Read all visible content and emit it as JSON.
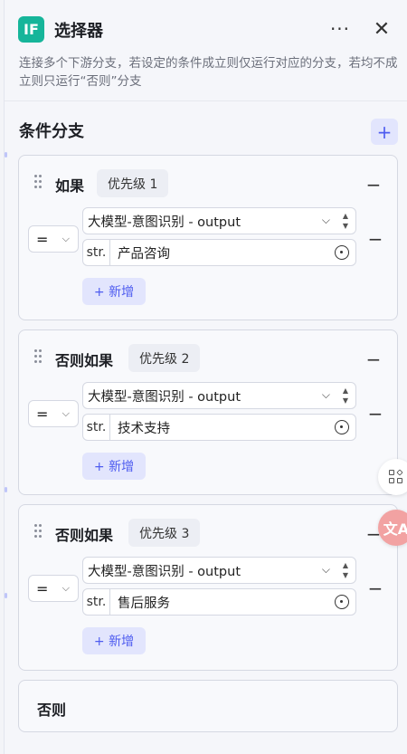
{
  "header": {
    "icon_text": "IF",
    "title": "选择器",
    "more_label": "···",
    "close_label": "✕",
    "description": "连接多个下游分支，若设定的条件成立则仅运行对应的分支，若均不成立则只运行“否则”分支"
  },
  "section": {
    "title": "条件分支",
    "add_label": "+"
  },
  "branches": [
    {
      "label": "如果",
      "priority": "优先级 1",
      "operator": "=",
      "variable": "大模型-意图识别 - output",
      "type_tag": "str.",
      "value": "产品咨询",
      "add_label": "+ 新增"
    },
    {
      "label": "否则如果",
      "priority": "优先级 2",
      "operator": "=",
      "variable": "大模型-意图识别 - output",
      "type_tag": "str.",
      "value": "技术支持",
      "add_label": "+ 新增"
    },
    {
      "label": "否则如果",
      "priority": "优先级 3",
      "operator": "=",
      "variable": "大模型-意图识别 - output",
      "type_tag": "str.",
      "value": "售后服务",
      "add_label": "+ 新增"
    }
  ],
  "else_branch": {
    "label": "否则"
  },
  "floating": {
    "translate_label": "文A"
  },
  "colors": {
    "accent": "#4e5cf0",
    "node_icon_bg": "#16b59a",
    "add_bg": "#e2e5fd",
    "translate_bg": "#f2a2a2"
  }
}
